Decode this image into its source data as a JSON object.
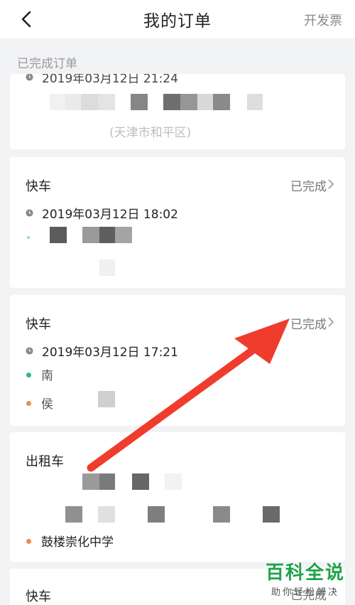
{
  "header": {
    "title": "我的订单",
    "action": "开发票"
  },
  "section": {
    "label": "已完成订单"
  },
  "orders": [
    {
      "time": "2019年03月12日 21:24",
      "address": "(天津市和平区)"
    },
    {
      "type": "快车",
      "status": "已完成",
      "time": "2019年03月12日 18:02"
    },
    {
      "type": "快车",
      "status": "已完成",
      "time": "2019年03月12日 17:21",
      "origin": "南",
      "destination": "侯"
    },
    {
      "type": "出租车",
      "destination": "鼓楼崇化中学"
    },
    {
      "type": "快车",
      "status": "已完成"
    }
  ],
  "watermark": {
    "main": "百科全说",
    "sub": "助你轻松解决"
  },
  "colors": {
    "accent_arrow": "#f03c2d",
    "origin_dot": "#2fb59a",
    "destination_dot": "#f08a4b",
    "watermark_green": "#1fa34a"
  }
}
